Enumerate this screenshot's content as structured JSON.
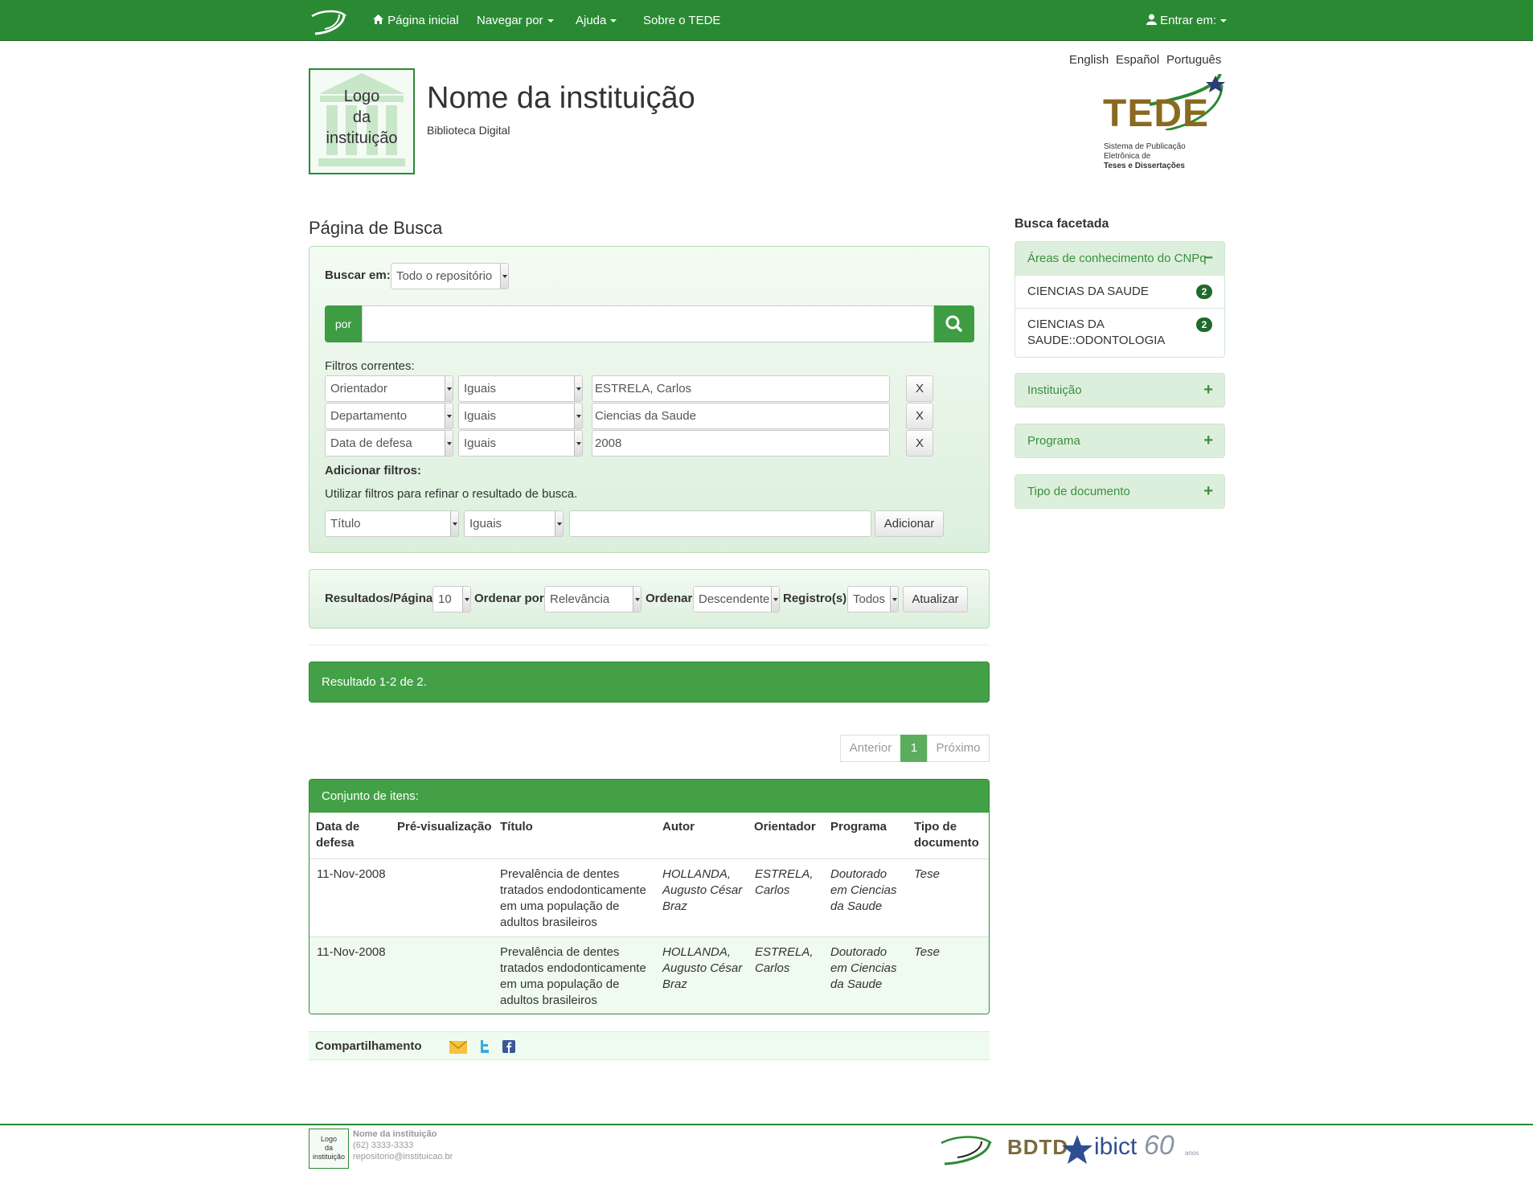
{
  "nav": {
    "home": "Página inicial",
    "browse": "Navegar por",
    "help": "Ajuda",
    "about": "Sobre o TEDE",
    "login": "Entrar em:"
  },
  "languages": [
    "English",
    "Español",
    "Português"
  ],
  "header": {
    "logo_text": [
      "Logo",
      "da",
      "instituição"
    ],
    "institution_name": "Nome da instituição",
    "subtitle": "Biblioteca Digital",
    "tede_lines": [
      "TEDE",
      "Sistema de Publicação",
      "Eletrônica de",
      "Teses e Dissertações"
    ]
  },
  "search": {
    "page_title": "Página de Busca",
    "scope_label": "Buscar em:",
    "scope_value": "Todo o repositório",
    "query_prefix": "por",
    "query_value": "",
    "current_filters_label": "Filtros correntes:",
    "filters": [
      {
        "field": "Orientador",
        "op": "Iguais",
        "value": "ESTRELA, Carlos",
        "remove": "X"
      },
      {
        "field": "Departamento",
        "op": "Iguais",
        "value": "Ciencias da Saude",
        "remove": "X"
      },
      {
        "field": "Data de defesa",
        "op": "Iguais",
        "value": "2008",
        "remove": "X"
      }
    ],
    "add_filters_label": "Adicionar filtros:",
    "add_filters_help": "Utilizar filtros para refinar o resultado de busca.",
    "new_filter": {
      "field": "Título",
      "op": "Iguais",
      "value": "",
      "button": "Adicionar"
    }
  },
  "sort": {
    "rpp_label": "Resultados/Página",
    "rpp_value": "10",
    "sort_by_label": "Ordenar por",
    "sort_by_value": "Relevância",
    "order_label": "Ordenar",
    "order_value": "Descendente",
    "records_label": "Registro(s)",
    "records_value": "Todos",
    "update_button": "Atualizar"
  },
  "results": {
    "summary": "Resultado 1-2 de 2.",
    "pagination": {
      "prev": "Anterior",
      "current": "1",
      "next": "Próximo"
    },
    "items_title": "Conjunto de itens:",
    "columns": [
      [
        "Data de",
        "defesa"
      ],
      [
        "Pré-visualização"
      ],
      [
        "Título"
      ],
      [
        "Autor"
      ],
      [
        "Orientador"
      ],
      [
        "Programa"
      ],
      [
        "Tipo de",
        "documento"
      ]
    ],
    "rows": [
      {
        "date": "11-Nov-2008",
        "preview": "",
        "title": [
          "Prevalência de dentes",
          "tratados endodonticamente",
          "em uma população de",
          "adultos brasileiros"
        ],
        "author": [
          "HOLLANDA,",
          "Augusto César",
          "Braz"
        ],
        "advisor": [
          "ESTRELA,",
          "Carlos"
        ],
        "program": [
          "Doutorado",
          "em Ciencias",
          "da Saude"
        ],
        "type": "Tese"
      },
      {
        "date": "11-Nov-2008",
        "preview": "",
        "title": [
          "Prevalência de dentes",
          "tratados endodonticamente",
          "em uma população de",
          "adultos brasileiros"
        ],
        "author": [
          "HOLLANDA,",
          "Augusto César",
          "Braz"
        ],
        "advisor": [
          "ESTRELA,",
          "Carlos"
        ],
        "program": [
          "Doutorado",
          "em Ciencias",
          "da Saude"
        ],
        "type": "Tese"
      }
    ],
    "share_label": "Compartilhamento"
  },
  "facets": {
    "title": "Busca facetada",
    "groups": [
      {
        "label": "Áreas de conhecimento do CNPq",
        "expanded": true,
        "items": [
          {
            "label": [
              "CIENCIAS DA SAUDE"
            ],
            "count": "2"
          },
          {
            "label": [
              "CIENCIAS DA",
              "SAUDE::ODONTOLOGIA"
            ],
            "count": "2"
          }
        ]
      },
      {
        "label": "Instituição",
        "expanded": false,
        "items": []
      },
      {
        "label": "Programa",
        "expanded": false,
        "items": []
      },
      {
        "label": "Tipo de documento",
        "expanded": false,
        "items": []
      }
    ]
  },
  "footer": {
    "name": "Nome da instituição",
    "phone": "(62) 3333-3333",
    "email": "repositorio@instituicao.br",
    "partners": [
      "BDTD",
      "ibict",
      "60",
      "anos"
    ]
  },
  "colors": {
    "brand_green": "#2a8a33",
    "panel_green": "#dcefdc",
    "badge": "#1f6a2c"
  },
  "icons": [
    "home-icon",
    "user-icon",
    "search-icon",
    "email-icon",
    "twitter-icon",
    "facebook-icon"
  ]
}
